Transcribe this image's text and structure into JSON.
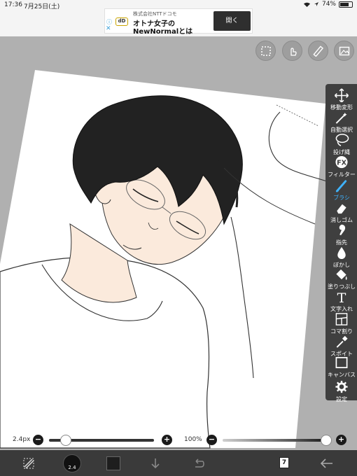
{
  "status_bar": {
    "time": "17:36",
    "date": "7月25日(土)",
    "battery": "74%",
    "battery_level": 0.74
  },
  "ad": {
    "logo": "dD",
    "company": "株式会社NTTドコモ",
    "line1": "オトナ女子の",
    "line2": "NewNormalとは",
    "open_button": "開く",
    "info": "ⓘ",
    "close": "✕"
  },
  "top_buttons": [
    "selection-icon",
    "hand-icon",
    "ruler-icon",
    "image-icon"
  ],
  "tools": [
    {
      "label": "移動変形",
      "icon": "move-icon"
    },
    {
      "label": "自動選択",
      "icon": "magic-wand-icon"
    },
    {
      "label": "投げ縄",
      "icon": "lasso-icon"
    },
    {
      "label": "フィルター",
      "icon": "fx-icon"
    },
    {
      "label": "ブラシ",
      "icon": "brush-icon",
      "active": true
    },
    {
      "label": "消しゴム",
      "icon": "eraser-icon"
    },
    {
      "label": "指先",
      "icon": "finger-icon"
    },
    {
      "label": "ぼかし",
      "icon": "blur-icon"
    },
    {
      "label": "塗りつぶし",
      "icon": "bucket-icon"
    },
    {
      "label": "文字入れ",
      "icon": "text-icon"
    },
    {
      "label": "コマ割り",
      "icon": "frame-icon"
    },
    {
      "label": "スポイト",
      "icon": "eyedropper-icon"
    },
    {
      "label": "キャンバス",
      "icon": "canvas-icon"
    },
    {
      "label": "設定",
      "icon": "gear-icon"
    }
  ],
  "sliders": {
    "brush_size_label": "2.4px",
    "brush_size_fraction": 0.05,
    "opacity_label": "100%",
    "opacity_fraction": 1.0
  },
  "bottom": {
    "brush_size_text": "2.4",
    "page_count": "7",
    "colors": {
      "primary": "#1e1e1e",
      "accent": "#3fb3ff"
    }
  }
}
